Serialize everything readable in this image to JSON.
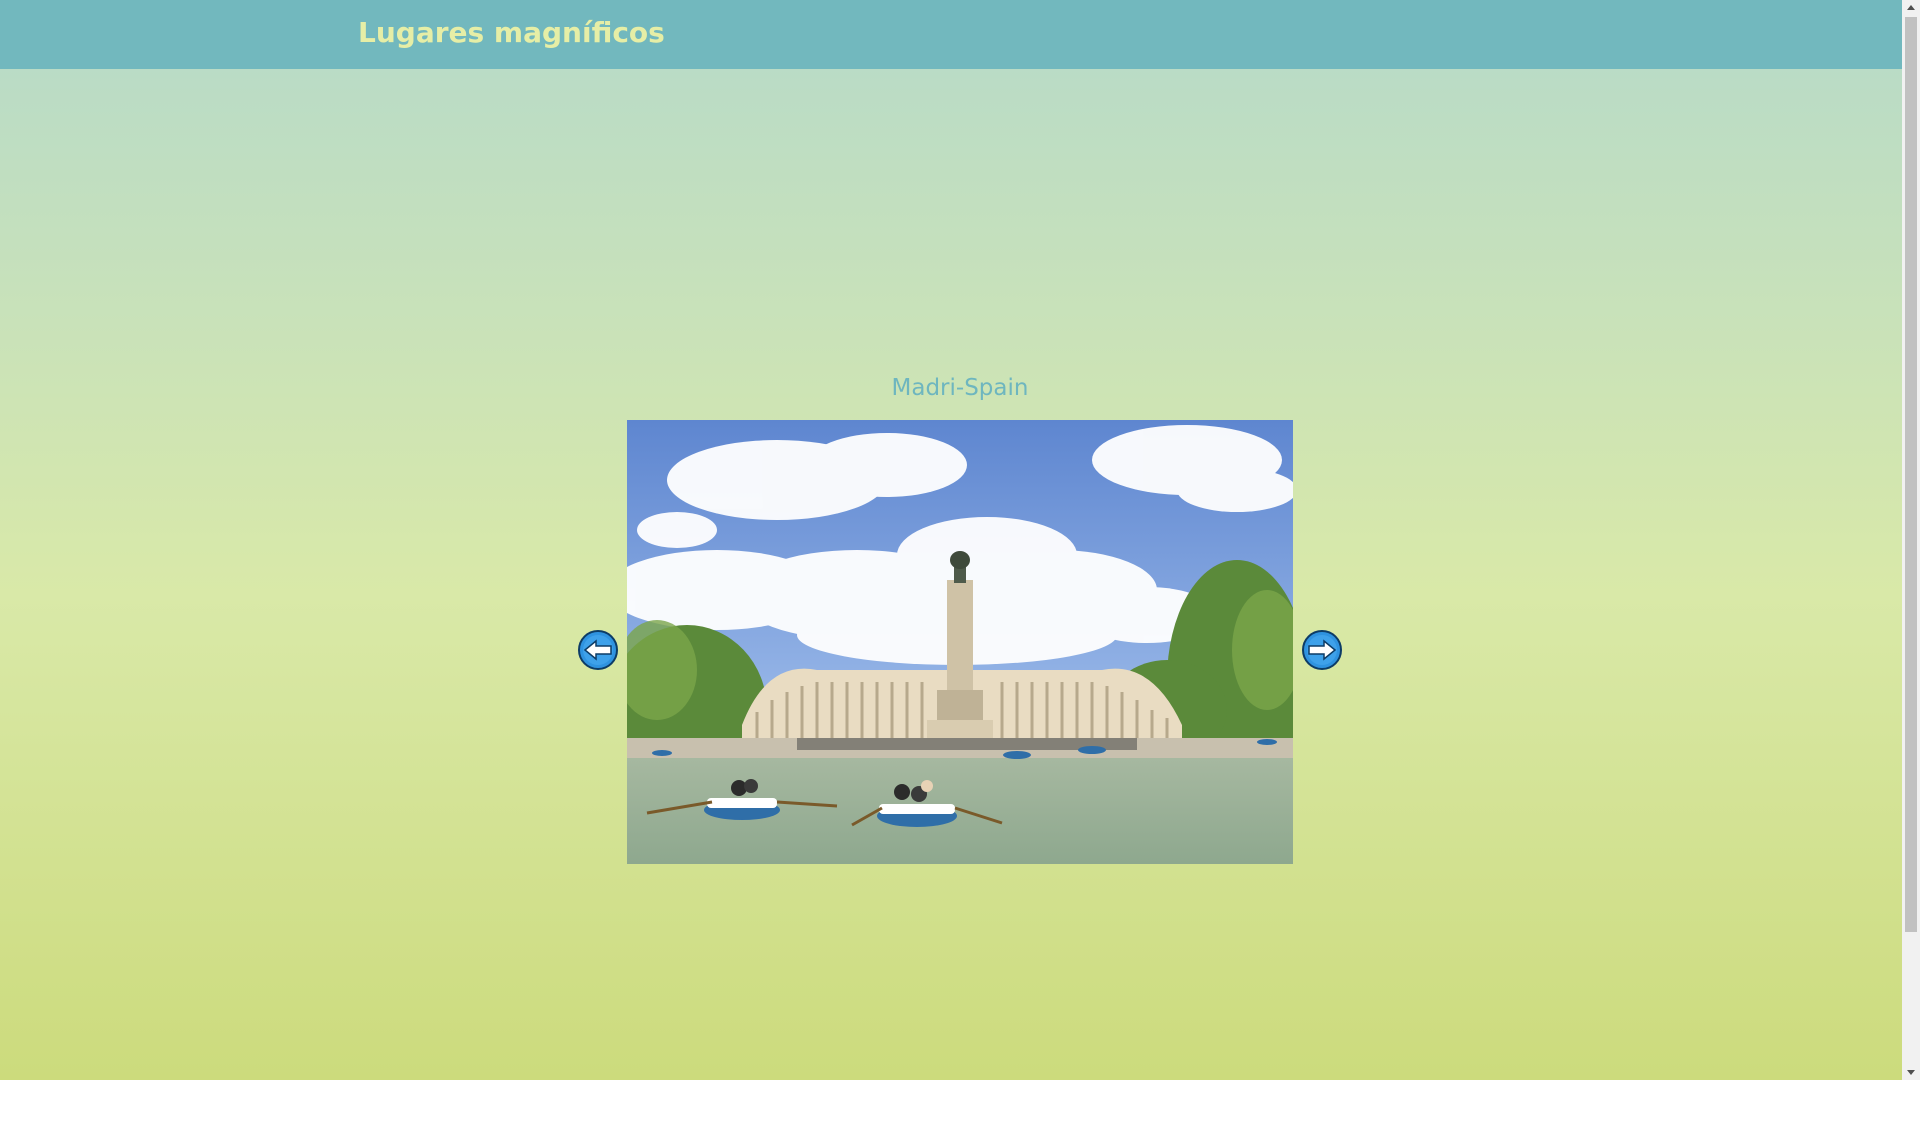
{
  "header": {
    "title": "Lugares magníficos",
    "background_color": "#72b8be",
    "title_color": "#e6eea6"
  },
  "gallery": {
    "caption": "Madri-Spain",
    "caption_color": "#6eb6bf",
    "photo_alt": "Madri-Spain",
    "prev_icon": "arrow-left-circle-icon",
    "next_icon": "arrow-right-circle-icon",
    "arrow_color": "#2f93e0"
  }
}
